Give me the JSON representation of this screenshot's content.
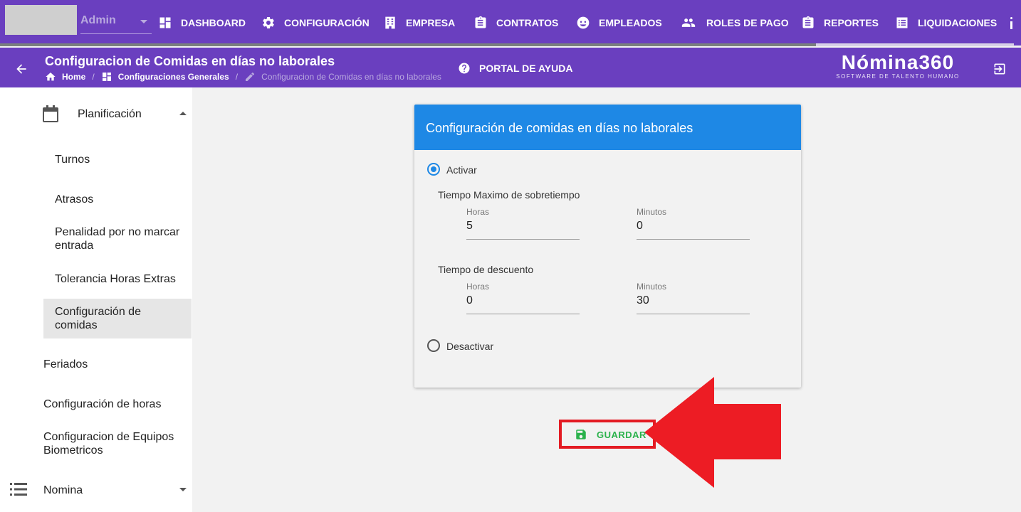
{
  "topnav": {
    "user": "Admin",
    "items": [
      {
        "label": "DASHBOARD",
        "icon": "dashboard-icon"
      },
      {
        "label": "CONFIGURACIÓN",
        "icon": "gear-icon"
      },
      {
        "label": "EMPRESA",
        "icon": "building-icon"
      },
      {
        "label": "CONTRATOS",
        "icon": "clipboard-icon"
      },
      {
        "label": "EMPLEADOS",
        "icon": "face-icon"
      },
      {
        "label": "ROLES DE PAGO",
        "icon": "people-icon"
      },
      {
        "label": "REPORTES",
        "icon": "clipboard-icon"
      },
      {
        "label": "LIQUIDACIONES",
        "icon": "list-icon"
      }
    ]
  },
  "header": {
    "title": "Configuracion de Comidas en días no laborales",
    "breadcrumb": [
      "Home",
      "Configuraciones Generales",
      "Configuracion de Comidas en días no laborales"
    ],
    "help": "PORTAL DE AYUDA",
    "logo": "Nómina360",
    "logo_sub": "SOFTWARE DE TALENTO HUMANO"
  },
  "sidebar": {
    "group": "Planificación",
    "sub_items": [
      "Turnos",
      "Atrasos",
      "Penalidad por no marcar entrada",
      "Tolerancia Horas Extras",
      "Configuración de comidas"
    ],
    "items": [
      "Feriados",
      "Configuración de horas",
      "Configuracion de Equipos Biometricos"
    ],
    "nomina": "Nomina"
  },
  "card": {
    "title": "Configuración de comidas en días no laborales",
    "activar": "Activar",
    "desactivar": "Desactivar",
    "selected": "Activar",
    "sobretiempo": {
      "label": "Tiempo Maximo de sobretiempo",
      "horas_label": "Horas",
      "horas": "5",
      "minutos_label": "Minutos",
      "minutos": "0"
    },
    "descuento": {
      "label": "Tiempo de descuento",
      "horas_label": "Horas",
      "horas": "0",
      "minutos_label": "Minutos",
      "minutos": "30"
    }
  },
  "actions": {
    "save": "GUARDAR"
  },
  "colors": {
    "primary": "#6a3fbf",
    "card_header": "#1e88e5",
    "save": "#2bb24c",
    "highlight": "#e31b23"
  }
}
